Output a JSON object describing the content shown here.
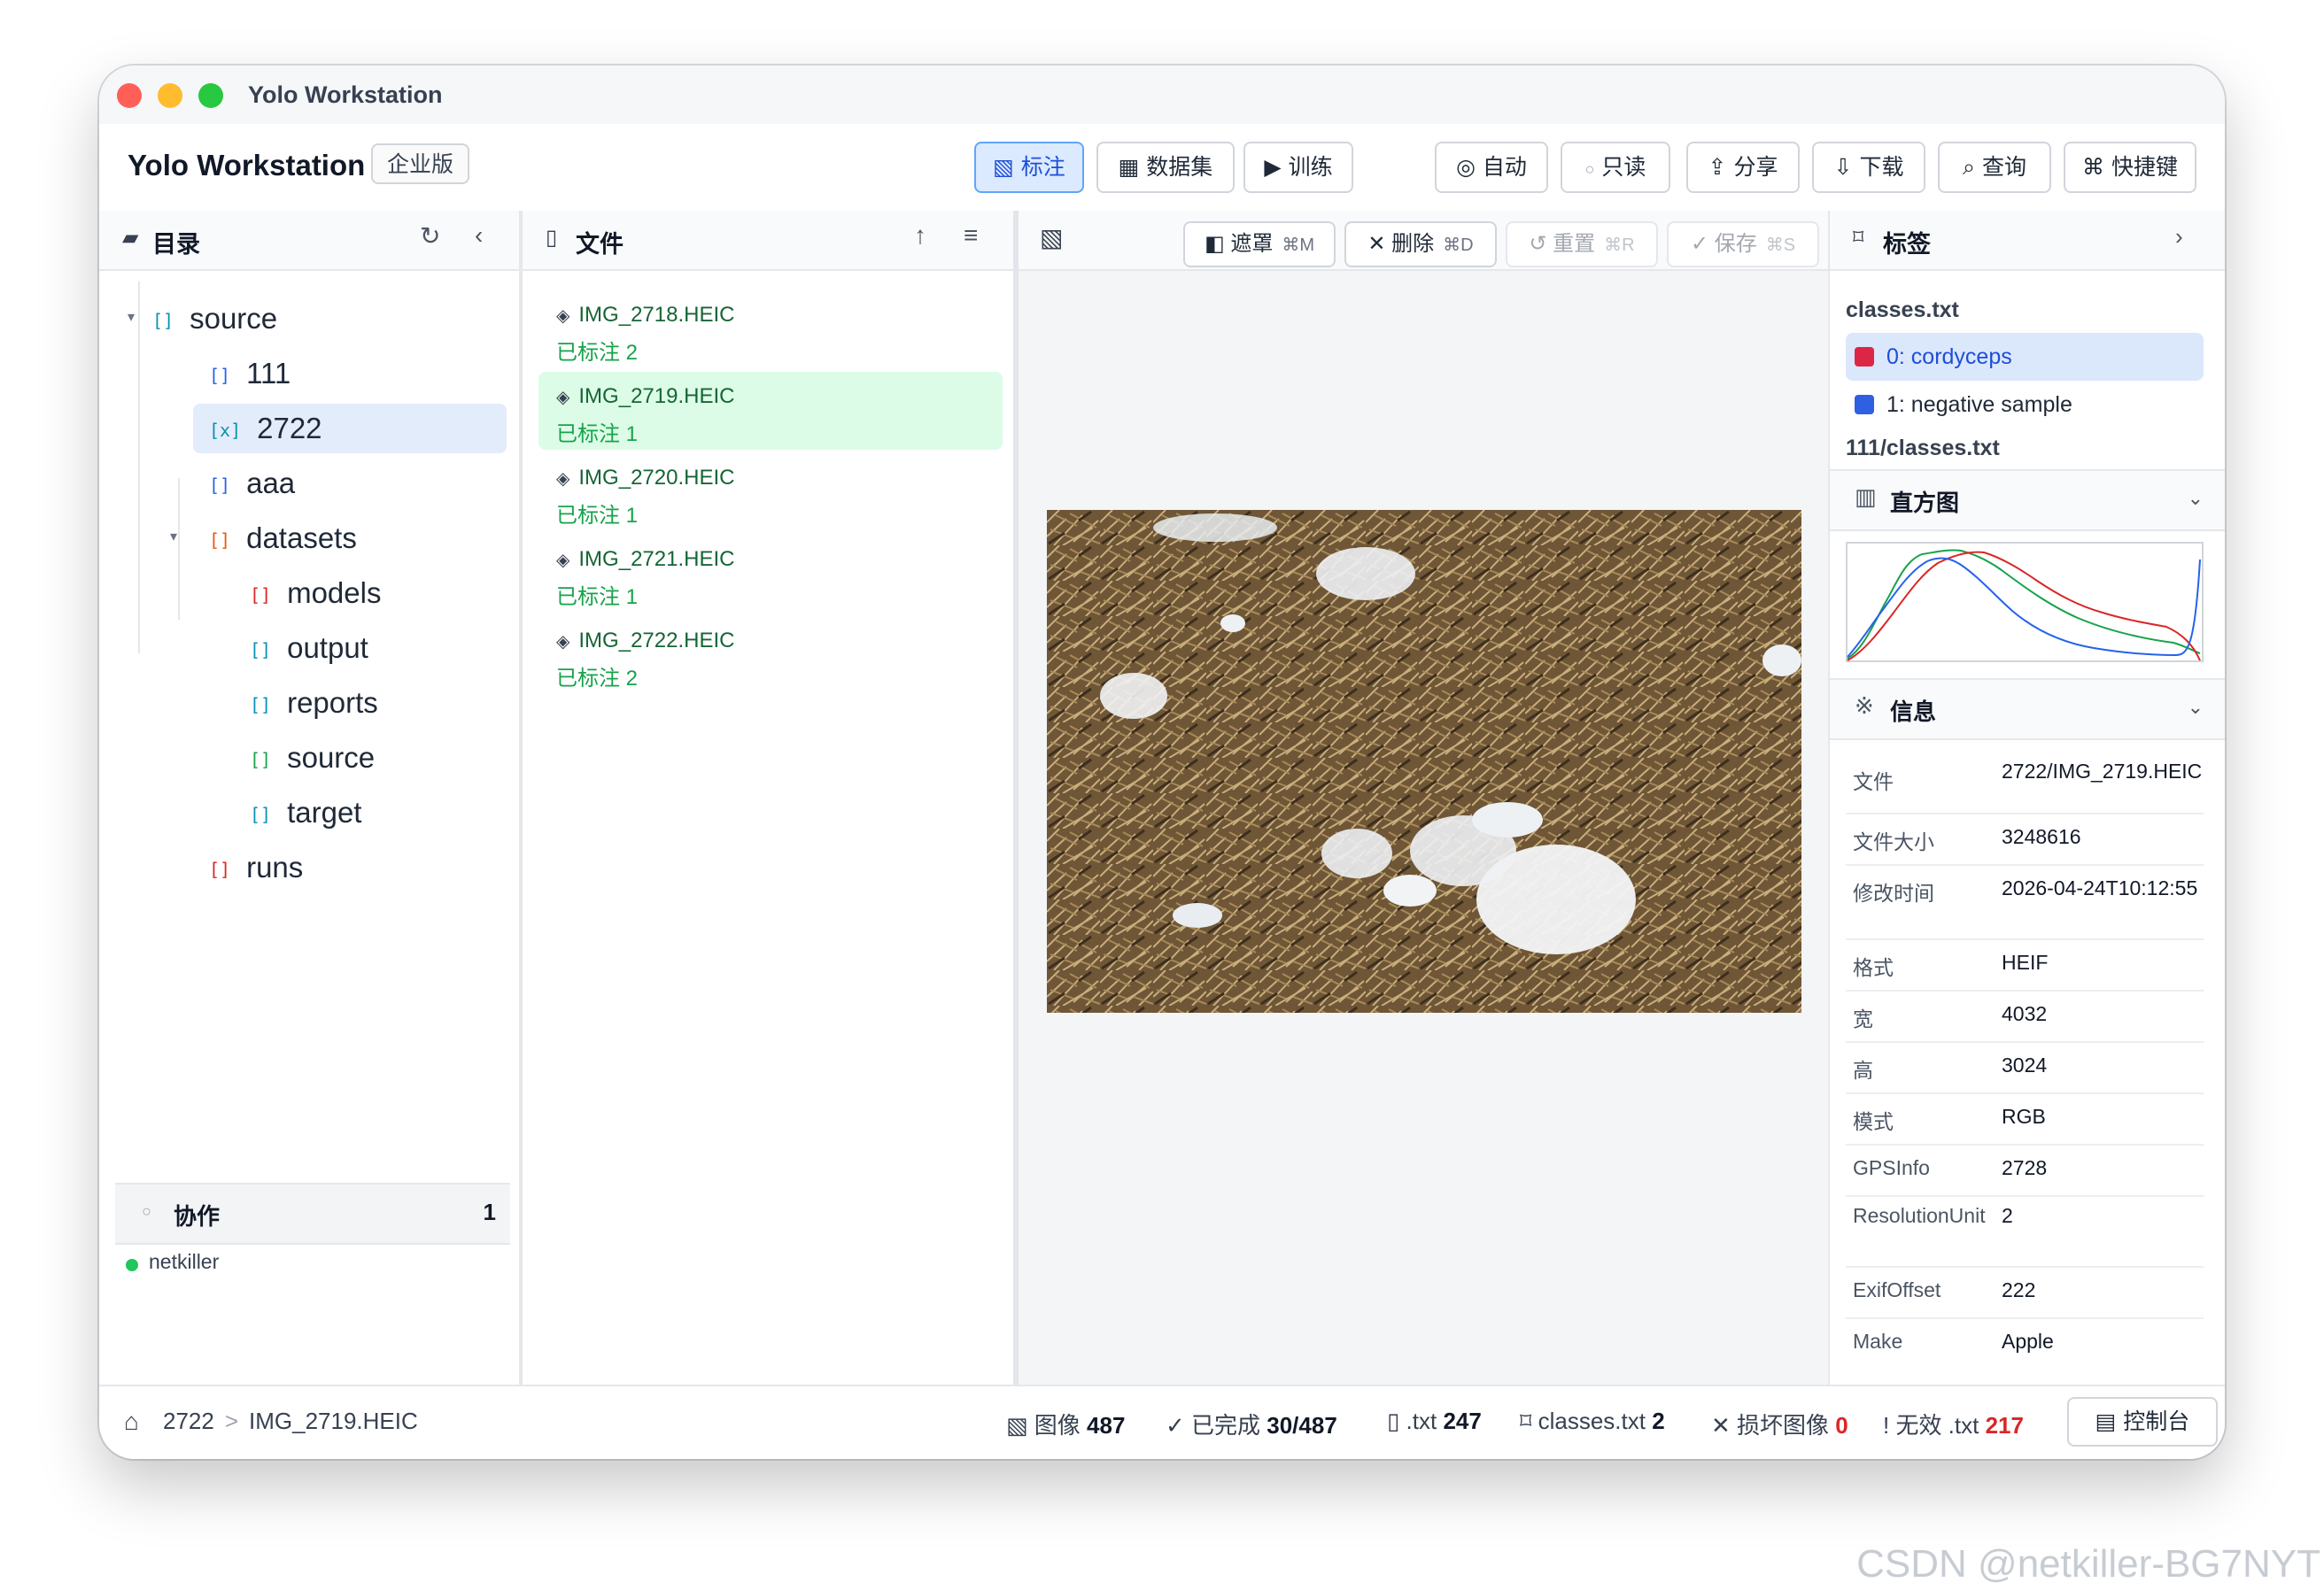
{
  "window": {
    "title": "Yolo Workstation"
  },
  "app": {
    "brand": "Yolo Workstation",
    "edition": "企业版"
  },
  "toolbar": {
    "annotate": "标注",
    "dataset": "数据集",
    "train": "训练",
    "auto": "自动",
    "readonly": "只读",
    "share": "分享",
    "download": "下载",
    "query": "查询",
    "shortcuts": "快捷键"
  },
  "directory": {
    "title": "目录",
    "tree": [
      "source",
      "111",
      "2722",
      "aaa",
      "datasets",
      "models",
      "output",
      "reports",
      "source",
      "target",
      "runs"
    ]
  },
  "collab": {
    "title": "协作",
    "count": "1",
    "user": "netkiller"
  },
  "files": {
    "title": "文件",
    "items": [
      {
        "name": "IMG_2718.HEIC",
        "status": "已标注 2"
      },
      {
        "name": "IMG_2719.HEIC",
        "status": "已标注 1"
      },
      {
        "name": "IMG_2720.HEIC",
        "status": "已标注 1"
      },
      {
        "name": "IMG_2721.HEIC",
        "status": "已标注 1"
      },
      {
        "name": "IMG_2722.HEIC",
        "status": "已标注 2"
      }
    ]
  },
  "canvas": {
    "mask": "遮罩",
    "mask_key": "⌘M",
    "delete": "删除",
    "delete_key": "⌘D",
    "reset": "重置",
    "reset_key": "⌘R",
    "save": "保存",
    "save_key": "⌘S"
  },
  "labels": {
    "title": "标签",
    "file1": "classes.txt",
    "classes": [
      {
        "label": "0: cordyceps",
        "color": "#dc2645"
      },
      {
        "label": "1: negative sample",
        "color": "#2f5fe3"
      }
    ],
    "file2": "111/classes.txt"
  },
  "histogram": {
    "title": "直方图"
  },
  "info": {
    "title": "信息",
    "rows": [
      {
        "key": "文件",
        "value": "2722/IMG_2719.HEIC"
      },
      {
        "key": "文件大小",
        "value": "3248616"
      },
      {
        "key": "修改时间",
        "value": "2026-04-24T10:12:55"
      },
      {
        "key": "格式",
        "value": "HEIF"
      },
      {
        "key": "宽",
        "value": "4032"
      },
      {
        "key": "高",
        "value": "3024"
      },
      {
        "key": "模式",
        "value": "RGB"
      },
      {
        "key": "GPSInfo",
        "value": "2728"
      },
      {
        "key": "ResolutionUnit",
        "value": "2"
      },
      {
        "key": "ExifOffset",
        "value": "222"
      },
      {
        "key": "Make",
        "value": "Apple"
      }
    ]
  },
  "status": {
    "crumb1": "2722",
    "sep": ">",
    "crumb2": "IMG_2719.HEIC",
    "images_label": "图像",
    "images_val": "487",
    "done_label": "已完成",
    "done_val": "30/487",
    "txt_label": ".txt",
    "txt_val": "247",
    "classes_label": "classes.txt",
    "classes_val": "2",
    "broken_label": "损坏图像",
    "broken_val": "0",
    "invalid_label": "无效 .txt",
    "invalid_val": "217",
    "console": "控制台"
  },
  "watermark": "CSDN @netkiller-BG7NYT"
}
